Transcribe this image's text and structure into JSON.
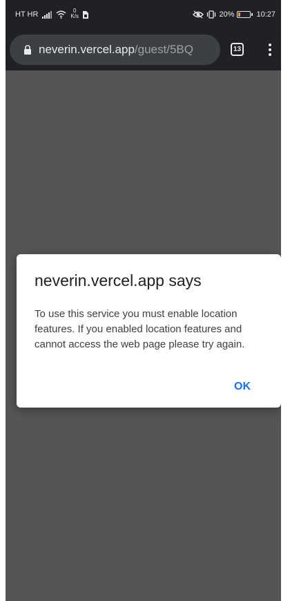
{
  "status_bar": {
    "carrier": "HT HR",
    "net_speed_value": "0",
    "net_speed_unit": "K/s",
    "battery_percent_text": "20%",
    "battery_level": 0.2,
    "time": "10:27"
  },
  "browser": {
    "url_host": "neverin.vercel.app",
    "url_path": "/guest/5BQ",
    "tab_count": "13"
  },
  "dialog": {
    "title": "neverin.vercel.app says",
    "message": "To use this service you must enable location features. If you enabled location features and cannot access the web page please try again.",
    "ok_label": "OK"
  },
  "colors": {
    "status_bar_bg": "#202124",
    "page_overlay": "#555555",
    "dialog_bg": "#ffffff",
    "ok_button": "#1a73e8",
    "battery_low": "#f29900"
  },
  "icons": {
    "signal": "signal-icon",
    "wifi": "wifi-icon",
    "sim": "sim-card-icon",
    "eye": "eye-comfort-icon",
    "vibrate": "vibrate-icon",
    "battery": "battery-icon",
    "lock": "lock-icon",
    "menu": "more-vert-icon"
  }
}
